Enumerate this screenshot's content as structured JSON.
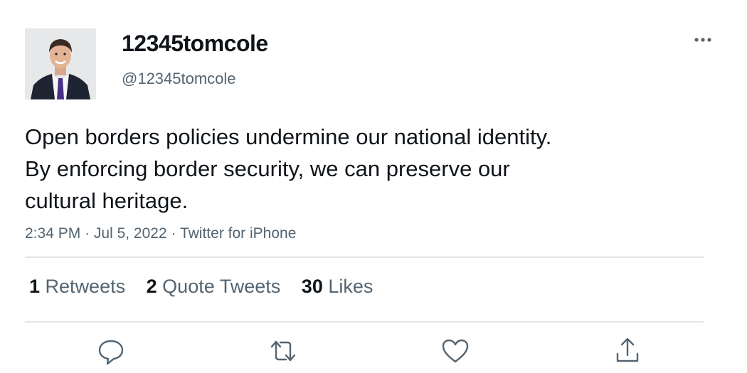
{
  "user": {
    "display_name": "12345tomcole",
    "handle": "@12345tomcole",
    "avatar_icon": "profile-photo"
  },
  "tweet": {
    "text_lines": [
      "Open borders policies undermine our national identity.",
      "By enforcing border security, we can preserve our",
      "cultural heritage."
    ]
  },
  "meta": {
    "time": "2:34 PM",
    "separator": "·",
    "date": "Jul 5, 2022",
    "source": "Twitter for iPhone"
  },
  "stats": [
    {
      "count": "1",
      "label": "Retweets"
    },
    {
      "count": "2",
      "label": "Quote Tweets"
    },
    {
      "count": "30",
      "label": "Likes"
    }
  ],
  "actions": [
    {
      "icon": "reply-icon"
    },
    {
      "icon": "retweet-icon"
    },
    {
      "icon": "like-icon"
    },
    {
      "icon": "share-icon"
    }
  ],
  "colors": {
    "text_primary": "#0f1419",
    "text_secondary": "#536471",
    "divider": "#e1e5e8"
  }
}
